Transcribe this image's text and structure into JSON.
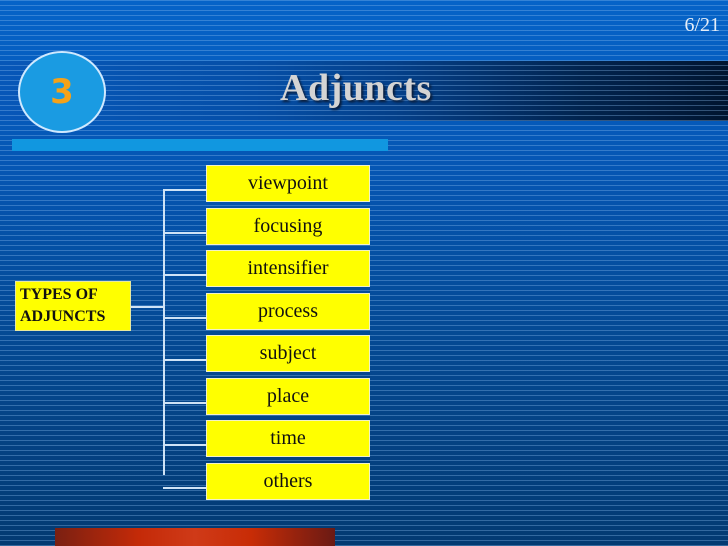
{
  "slide": {
    "number_label": "6/21",
    "section_number": "3",
    "title": "Adjuncts"
  },
  "diagram": {
    "root_label_line1": "TYPES OF",
    "root_label_line2": "ADJUNCTS",
    "items": [
      "viewpoint",
      "focusing",
      "intensifier",
      "process",
      "subject",
      "place",
      "time",
      "others"
    ]
  },
  "colors": {
    "box_fill": "#ffff00",
    "badge_number": "#f4a21a",
    "badge_fill": "#1a9be2",
    "accent_bar": "#1197e0"
  }
}
